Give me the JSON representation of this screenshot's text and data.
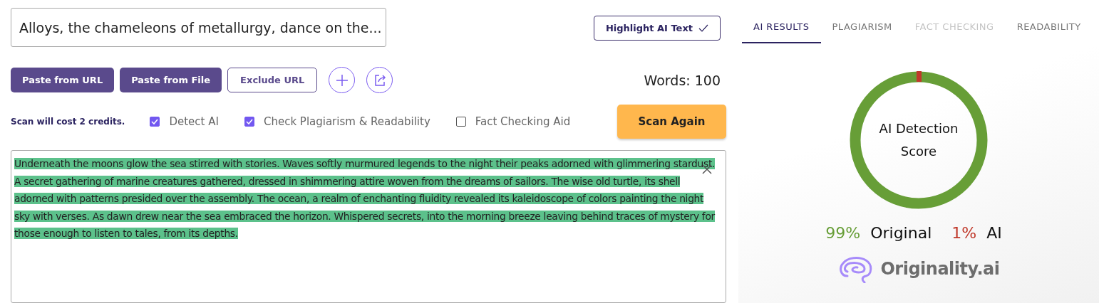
{
  "title_field": {
    "value": "Alloys, the chameleons of metallurgy, dance on the..."
  },
  "highlight_button": {
    "label": "Highlight AI Text",
    "checked": true
  },
  "tabs": [
    {
      "label": "AI RESULTS",
      "selected": true,
      "disabled": false
    },
    {
      "label": "PLAGIARISM",
      "selected": false,
      "disabled": false
    },
    {
      "label": "FACT CHECKING",
      "selected": false,
      "disabled": true
    },
    {
      "label": "READABILITY",
      "selected": false,
      "disabled": false
    }
  ],
  "actions": [
    {
      "kind": "filled",
      "label": "Paste from URL"
    },
    {
      "kind": "filled",
      "label": "Paste from File"
    },
    {
      "kind": "outline",
      "label": "Exclude URL"
    },
    {
      "kind": "add"
    },
    {
      "kind": "share"
    }
  ],
  "word_count": "Words: 100",
  "cost_note": "Scan will cost 2 credits.",
  "options": [
    {
      "label": "Detect AI",
      "checked": true
    },
    {
      "label": "Check Plagiarism & Readability",
      "checked": true
    },
    {
      "label": "Fact Checking Aid",
      "checked": false
    }
  ],
  "scan_button": "Scan Again",
  "text_area": {
    "value": "Underneath the moons glow the sea stirred with stories. Waves softly murmured legends to the night their peaks adorned with glimmering stardust. A secret gathering of marine creatures gathered, dressed in shimmering attire woven from the dreams of sailors. The wise old turtle, its shell adorned with patterns presided over the assembly. The ocean, a realm of enchanting fluidity revealed its kaleidoscope of colors painting the night sky with verses. As dawn drew near the sea embraced the horizon. Whispered secrets, into the morning breeze leaving behind traces of mystery for those enough to listen to tales, from its depths.",
    "highlighted": true
  },
  "results": {
    "score_title": "AI Detection Score",
    "legend": [
      {
        "percent": "99%",
        "label": "Original",
        "color": "#679e37"
      },
      {
        "percent": "1%",
        "label": "AI",
        "color": "#c0392b"
      }
    ],
    "logo_text": "Originality.ai"
  }
}
